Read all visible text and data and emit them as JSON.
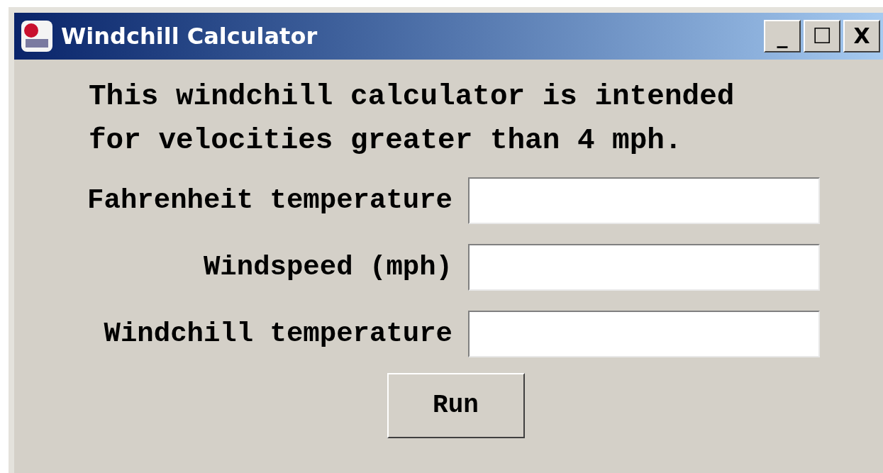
{
  "window": {
    "title": "Windchill Calculator"
  },
  "message": [
    "This windchill calculator is intended",
    "for velocities greater than 4 mph."
  ],
  "fields": [
    {
      "label": "Fahrenheit temperature"
    },
    {
      "label": "Windspeed (mph)"
    },
    {
      "label": "Windchill temperature"
    }
  ],
  "buttons": [
    "Run"
  ],
  "title_buttons": [
    "_",
    "☐",
    "X"
  ]
}
